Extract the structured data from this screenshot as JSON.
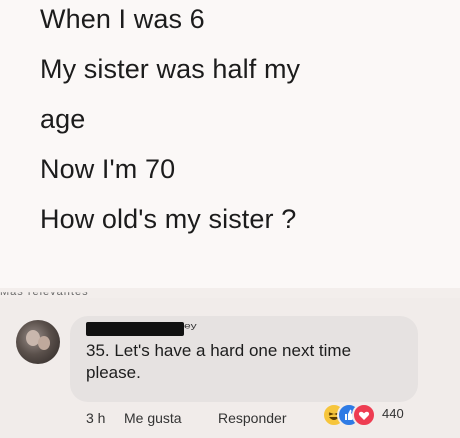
{
  "post": {
    "lines": [
      "When I was 6",
      "My sister was half my",
      "age",
      "Now I'm 70",
      "How old's my sister ?"
    ],
    "cutoff_text": "Más relevantes"
  },
  "comment": {
    "name_fragment": "ey",
    "text": "35. Let's have a hard one next time please.",
    "time": "3 h",
    "like_label": "Me gusta",
    "reply_label": "Responder",
    "reactions": {
      "icons": [
        "haha-icon",
        "like-icon",
        "love-icon"
      ],
      "count": "440"
    }
  },
  "colors": {
    "background": "#fbf8f7",
    "bubble": "#e6e2e1",
    "like_blue": "#2f7be5",
    "love_red": "#ee3d52",
    "haha_yellow": "#f6c53c"
  }
}
